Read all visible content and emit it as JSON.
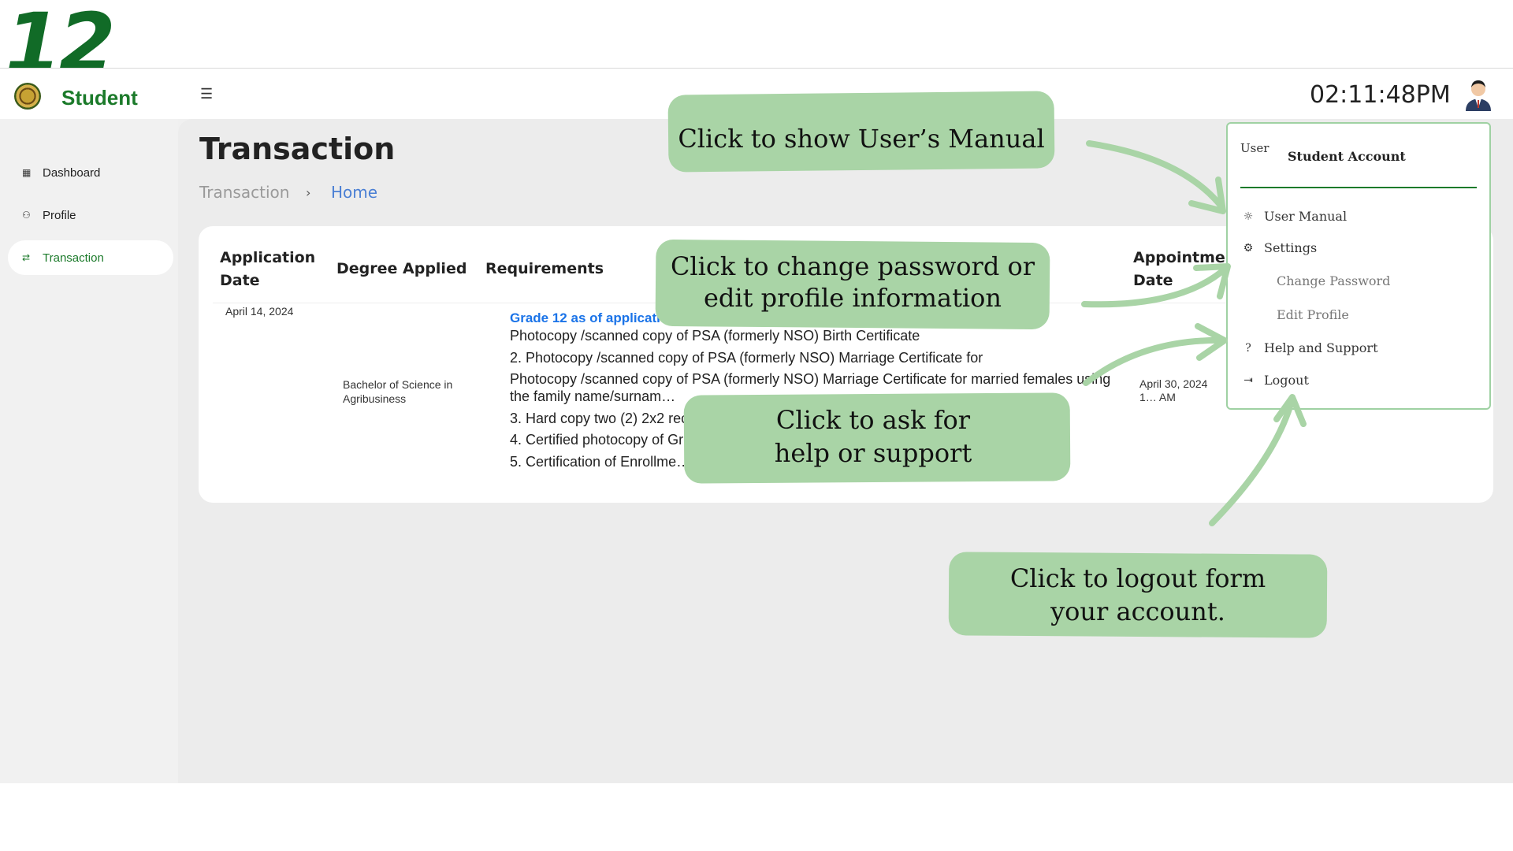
{
  "step_number": "12",
  "sidebar": {
    "app_name": "Student",
    "items": [
      {
        "label": "Dashboard",
        "icon": "grid-icon",
        "active": false
      },
      {
        "label": "Profile",
        "icon": "person-icon",
        "active": false
      },
      {
        "label": "Transaction",
        "icon": "swap-icon",
        "active": true
      }
    ]
  },
  "header": {
    "menu_icon": "hamburger-icon",
    "clock": "02:11:48PM",
    "avatar_icon": "user-avatar-icon"
  },
  "page": {
    "title": "Transaction",
    "breadcrumb": [
      "Transaction",
      "Home"
    ]
  },
  "table": {
    "headers": [
      "Application Date",
      "Degree Applied",
      "Requirements",
      "Appointment Date"
    ],
    "row": {
      "application_date": "April 14, 2024",
      "degree": "Bachelor of Science in Agribusiness",
      "requirements": [
        "Grade 12 as of application p…",
        "Photocopy /scanned copy of PSA (formerly NSO) Birth Certificate",
        "2. Photocopy /scanned copy of PSA (formerly NSO) Marriage Certificate for",
        "Photocopy /scanned copy of PSA (formerly NSO) Marriage Certificate for married females using the family name/surnam…",
        "3. Hard copy two (2) 2x2 rec… …ature",
        "4. Certified photocopy of Gr…",
        "5. Certification of Enrollme…"
      ],
      "appointment_date": "April 30, 2024 1… AM"
    }
  },
  "dropdown": {
    "user_image_alt": "User",
    "title": "Student Account",
    "items": [
      {
        "label": "User Manual",
        "icon": "sun-icon"
      },
      {
        "label": "Settings",
        "icon": "gear-icon"
      },
      {
        "label": "Change Password",
        "icon": ""
      },
      {
        "label": "Edit Profile",
        "icon": ""
      },
      {
        "label": "Help and Support",
        "icon": "question-icon"
      },
      {
        "label": "Logout",
        "icon": "logout-icon"
      }
    ]
  },
  "callouts": {
    "manual": "Click to show User’s Manual",
    "password_1": "Click to change password or",
    "password_2": "edit profile information",
    "help_1": "Click to ask for",
    "help_2": "help or support",
    "logout_1": "Click to logout form",
    "logout_2": "your account."
  },
  "colors": {
    "brand_green": "#1b7a2a",
    "highlight_green": "#a9d4a6",
    "link_blue": "#1a73e8"
  }
}
